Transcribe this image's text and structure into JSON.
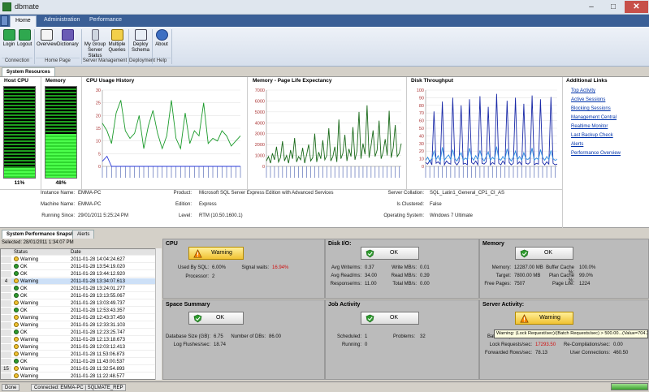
{
  "window": {
    "title": "dbmate",
    "min_label": "–",
    "max_label": "□",
    "close_label": "✕"
  },
  "ribbon": {
    "tabs": [
      "Home",
      "Administration",
      "Performance"
    ],
    "buttons": [
      {
        "label": "Login",
        "icon": "login-icon"
      },
      {
        "label": "Logout",
        "icon": "logout-icon"
      },
      {
        "label": "Overview",
        "icon": "overview-icon"
      },
      {
        "label": "Dictionary",
        "icon": "dictionary-icon"
      },
      {
        "label": "My Group",
        "label2": "Server Status",
        "icon": "server-status-icon"
      },
      {
        "label": "Multiple",
        "label2": "Queries",
        "icon": "queries-icon"
      },
      {
        "label": "Deploy",
        "label2": "Schema",
        "icon": "deploy-icon"
      },
      {
        "label": "About",
        "icon": "about-icon"
      }
    ],
    "groups": [
      "Connection",
      "Home Page",
      "Server Management",
      "Deployment",
      "Help"
    ]
  },
  "system_resources": {
    "tab_label": "System Resources",
    "host_cpu": {
      "title": "Host CPU",
      "value": 11,
      "label": "11%"
    },
    "memory": {
      "title": "Memory",
      "value": 48,
      "label": "48%"
    },
    "cpu_history_title": "CPU Usage History",
    "ple_title": "Memory - Page Life Expectancy",
    "disk_title": "Disk Throughput",
    "links_title": "Additional Links",
    "links": [
      "Top Activity",
      "Active Sessions",
      "Blocking Sessions",
      "Management Central",
      "Realtime Monitor",
      "Last Backup Check",
      "Alerts",
      "Performance Overview"
    ],
    "info": {
      "instance_label": "Instance Name:",
      "instance": "EMMA-PC",
      "machine_label": "Machine Name:",
      "machine": "EMMA-PC",
      "running_label": "Running Since:",
      "running": "29/01/2011 5:25:24 PM",
      "product_label": "Product:",
      "product": "Microsoft SQL Server Express Edition with Advanced Services",
      "edition_label": "Edition:",
      "edition": "Express",
      "level_label": "Level:",
      "level": "RTM (10.50.1600.1)",
      "collation_label": "Server Collation:",
      "collation": "SQL_Latin1_General_CP1_CI_AS",
      "clustered_label": "Is Clustered:",
      "clustered": "False",
      "os_label": "Operating System:",
      "os": "Windows 7 Ultimate"
    }
  },
  "chart_data": [
    {
      "type": "line",
      "title": "CPU Usage History",
      "ylim": [
        0,
        30
      ],
      "yticks": [
        "30",
        "25",
        "20",
        "15",
        "10",
        "5",
        "0"
      ],
      "series": [
        {
          "color": "#1a9a2a",
          "values": [
            17,
            14,
            9,
            21,
            26,
            14,
            11,
            13,
            20,
            7,
            16,
            22,
            13,
            7,
            12,
            26,
            11,
            7,
            21,
            9,
            14,
            12,
            25,
            9,
            11,
            10,
            14,
            12,
            8,
            10,
            12
          ]
        },
        {
          "color": "#2a3ad8",
          "values": [
            2,
            4,
            0,
            0,
            0,
            0,
            0,
            0,
            0,
            0,
            0,
            0,
            0,
            0,
            0,
            0,
            0,
            0,
            0,
            0,
            0,
            0,
            0,
            0,
            0,
            0,
            0,
            0,
            0,
            0,
            0
          ]
        }
      ]
    },
    {
      "type": "line",
      "title": "Memory - Page Life Expectancy",
      "ylim": [
        0,
        7000
      ],
      "yticks": [
        "7000",
        "6000",
        "5000",
        "4000",
        "3000",
        "2000",
        "1000",
        "0"
      ],
      "series": [
        {
          "color": "#1a6a1a",
          "values": [
            500,
            900,
            300,
            1200,
            600,
            1800,
            400,
            800,
            2300,
            500,
            1000,
            300,
            1500,
            700,
            2600,
            400,
            900,
            600,
            1700,
            300,
            1100,
            2000,
            500,
            800,
            3000,
            400,
            1300,
            700,
            2400,
            600,
            1000,
            3500,
            500,
            900,
            1800,
            400,
            4300,
            700,
            1200,
            2900,
            500,
            1600,
            900,
            3600,
            600,
            1400,
            5000,
            700,
            2100,
            1100,
            5600,
            800,
            1900,
            3300,
            900,
            1500,
            4200,
            700,
            1300,
            2500,
            1000,
            5100,
            800,
            1700,
            3800,
            900,
            1200,
            2100
          ]
        }
      ]
    },
    {
      "type": "line",
      "title": "Disk Throughput",
      "ylim": [
        0,
        100
      ],
      "yticks": [
        "100",
        "90",
        "80",
        "70",
        "60",
        "50",
        "40",
        "30",
        "20",
        "10",
        "0"
      ],
      "series": [
        {
          "color": "#1a2aa8",
          "values": [
            5,
            3,
            8,
            2,
            72,
            4,
            6,
            3,
            85,
            2,
            7,
            4,
            3,
            90,
            5,
            2,
            6,
            80,
            3,
            4,
            2,
            88,
            5,
            3,
            7,
            2,
            92,
            4,
            3,
            6,
            78,
            2,
            5,
            3,
            95,
            4,
            2,
            7,
            3,
            86,
            5,
            2,
            4,
            90,
            3,
            6,
            2,
            82,
            4,
            3,
            5,
            93,
            2,
            4,
            3,
            88,
            5,
            2,
            6,
            3,
            91,
            4,
            2,
            3
          ]
        },
        {
          "color": "#2a8ae0",
          "values": [
            8,
            12,
            6,
            10,
            20,
            9,
            14,
            7,
            25,
            8,
            12,
            15,
            9,
            22,
            10,
            7,
            13,
            18,
            8,
            11,
            9,
            24,
            12,
            8,
            14,
            9,
            21,
            11,
            7,
            13,
            19,
            8,
            12,
            9,
            26,
            10,
            8,
            13,
            9,
            23,
            11,
            7,
            12,
            20,
            9,
            13,
            8,
            18,
            10,
            9,
            12,
            24,
            8,
            11,
            9,
            22,
            12,
            8,
            13,
            9,
            21,
            10,
            8,
            9
          ]
        }
      ]
    }
  ],
  "snapshots": {
    "tab_label": "System Performance Snapshots",
    "alerts_tab": "Alerts",
    "selected": "Selected: 28/01/2011 1:34:07 PM",
    "headers": {
      "status": "Status",
      "date": "Date"
    },
    "rows": [
      {
        "n": "",
        "status": "Warning",
        "date": "2011-01-28 14:04:24.627"
      },
      {
        "n": "",
        "status": "OK",
        "date": "2011-01-28 13:54:19.020"
      },
      {
        "n": "",
        "status": "OK",
        "date": "2011-01-28 13:44:12.920"
      },
      {
        "n": "4",
        "status": "Warning",
        "date": "2011-01-28 13:34:07.613"
      },
      {
        "n": "",
        "status": "OK",
        "date": "2011-01-28 13:24:01.277"
      },
      {
        "n": "",
        "status": "OK",
        "date": "2011-01-28 13:13:55.067"
      },
      {
        "n": "",
        "status": "Warning",
        "date": "2011-01-28 13:03:49.737"
      },
      {
        "n": "",
        "status": "OK",
        "date": "2011-01-28 12:53:43.357"
      },
      {
        "n": "",
        "status": "Warning",
        "date": "2011-01-28 12:43:37.450"
      },
      {
        "n": "",
        "status": "Warning",
        "date": "2011-01-28 12:33:31.103"
      },
      {
        "n": "",
        "status": "OK",
        "date": "2011-01-28 12:23:25.747"
      },
      {
        "n": "",
        "status": "Warning",
        "date": "2011-01-28 12:13:18.673"
      },
      {
        "n": "",
        "status": "Warning",
        "date": "2011-01-28 12:03:12.413"
      },
      {
        "n": "",
        "status": "Warning",
        "date": "2011-01-28 11:53:06.873"
      },
      {
        "n": "",
        "status": "OK",
        "date": "2011-01-28 11:43:00.537"
      },
      {
        "n": "15",
        "status": "Warning",
        "date": "2011-01-28 11:32:54.893"
      },
      {
        "n": "",
        "status": "Warning",
        "date": "2011-01-28 11:22:48.577"
      }
    ]
  },
  "panels": {
    "cpu": {
      "title": "CPU",
      "status": "Warning",
      "sql_label": "Used By SQL:",
      "sql": "6.00%",
      "wait_label": "Signal waits:",
      "wait": "16.94%",
      "proc_label": "Processor:",
      "proc": "2"
    },
    "disk": {
      "title": "Disk I/O:",
      "status": "OK",
      "avg_write_label": "Avg Write/ms:",
      "avg_write": "0.37",
      "write_mb_label": "Write MB/s:",
      "write_mb": "0.01",
      "avg_read_label": "Avg Read/ms:",
      "avg_read": "34.00",
      "read_mb_label": "Read MB/s:",
      "read_mb": "0.39",
      "resp_label": "Response/ms:",
      "resp": "11.00",
      "total_mb_label": "Total MB/s:",
      "total_mb": "0.00"
    },
    "memory": {
      "title": "Memory",
      "status": "OK",
      "mem_label": "Memory:",
      "mem": "12287.00 MB",
      "bc_label": "Buffer Cache %:",
      "bc": "100.0%",
      "target_label": "Target:",
      "target": "7800.00 MB",
      "pc_label": "Plan Cache %:",
      "pc": "99.0%",
      "free_label": "Free Pages:",
      "free": "7507",
      "ple_label": "Page Life:",
      "ple": "1224"
    },
    "space": {
      "title": "Space Summary",
      "status": "OK",
      "size_label": "Database Size (GB):",
      "size": "6.75",
      "dbs_label": "Number of DBs:",
      "dbs": "86.00",
      "log_label": "Log Flushes/sec:",
      "log": "18.74"
    },
    "job": {
      "title": "Job Activity",
      "status": "OK",
      "sched_label": "Scheduled:",
      "sched": "1",
      "prob_label": "Problems:",
      "prob": "32",
      "run_label": "Running:",
      "run": "0"
    },
    "server": {
      "title": "Server Activity:",
      "status": "Warning",
      "batch_label": "Batch Requests/sec:",
      "batch": "704.21",
      "lock_label": "Lock Requests/sec:",
      "lock": "17293.50",
      "recomp_label": "Re-Compilations/sec:",
      "recomp": "0.00",
      "fwd_label": "Forwarded Rows/sec:",
      "fwd": "78.13",
      "conn_label": "User Connections:",
      "conn": "460.50"
    },
    "tooltip": "Warning: (Lock Request/sec)/(Batch Requests/sec) > 500.00...(Value=704.21)..."
  },
  "status_bar": {
    "ready": "Done",
    "connected": "Connected: EMMA-PC | SQLMATE_REP"
  },
  "progress": {
    "value": 100
  },
  "colors": {
    "warning": "#f1c232",
    "ok": "#2e9b2e",
    "alert_text": "#d01010"
  }
}
